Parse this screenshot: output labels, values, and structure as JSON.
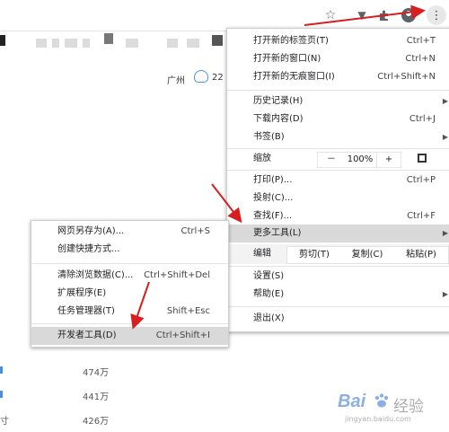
{
  "page": {
    "city": "广州",
    "temp": "22",
    "rank_values": [
      "474万",
      "441万",
      "426万"
    ],
    "snippet_char": "寸"
  },
  "chrome_menu": {
    "items": [
      {
        "label": "打开新的标签页(T)",
        "shortcut": "Ctrl+T"
      },
      {
        "label": "打开新的窗口(N)",
        "shortcut": "Ctrl+N"
      },
      {
        "label": "打开新的无痕窗口(I)",
        "shortcut": "Ctrl+Shift+N"
      },
      {
        "label": "历史记录(H)"
      },
      {
        "label": "下载内容(D)",
        "shortcut": "Ctrl+J"
      },
      {
        "label": "书签(B)"
      },
      {
        "label": "打印(P)...",
        "shortcut": "Ctrl+P"
      },
      {
        "label": "投射(C)..."
      },
      {
        "label": "查找(F)...",
        "shortcut": "Ctrl+F"
      },
      {
        "label": "更多工具(L)"
      },
      {
        "label": "设置(S)"
      },
      {
        "label": "帮助(E)"
      },
      {
        "label": "退出(X)"
      }
    ],
    "zoom": {
      "label": "缩放",
      "minus": "－",
      "value": "100%",
      "plus": "+"
    },
    "edit": {
      "label": "编辑",
      "cut": "剪切(T)",
      "copy": "复制(C)",
      "paste": "粘贴(P)"
    }
  },
  "sub_menu": {
    "items": [
      {
        "label": "网页另存为(A)...",
        "shortcut": "Ctrl+S"
      },
      {
        "label": "创建快捷方式..."
      },
      {
        "label": "清除浏览数据(C)...",
        "shortcut": "Ctrl+Shift+Del"
      },
      {
        "label": "扩展程序(E)"
      },
      {
        "label": "任务管理器(T)",
        "shortcut": "Shift+Esc"
      },
      {
        "label": "开发者工具(D)",
        "shortcut": "Ctrl+Shift+I"
      }
    ]
  },
  "watermark": {
    "brand": "Bai",
    "suffix": "经验",
    "url": "jingyan.baidu.com"
  },
  "colors": {
    "arrow": "#d81e1e",
    "highlight": "#d9d9d9",
    "baidu_blue": "#2f6fd6"
  }
}
